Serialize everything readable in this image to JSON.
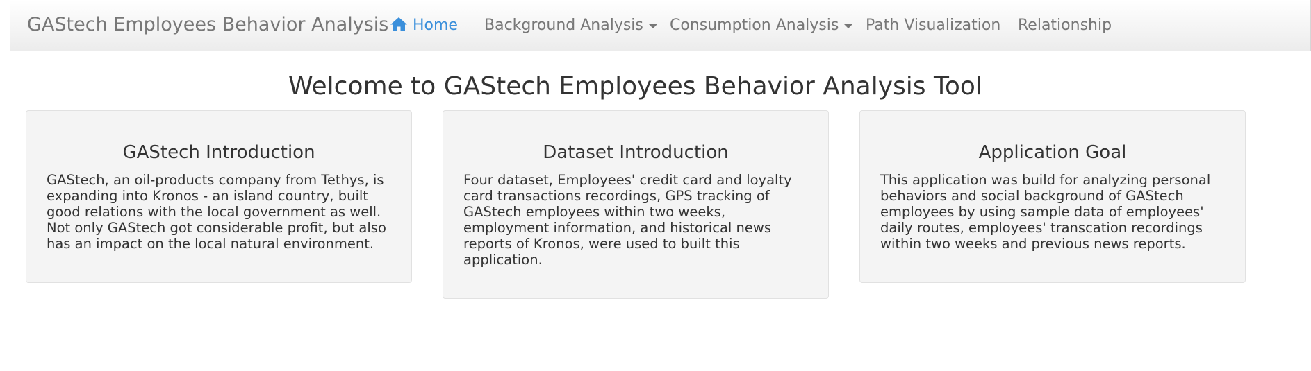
{
  "navbar": {
    "brand": "GAStech Employees Behavior Analysis",
    "items": [
      {
        "label": "Home",
        "active": true,
        "icon": "home-icon"
      },
      {
        "label": "Background Analysis",
        "dropdown": true
      },
      {
        "label": "Consumption Analysis",
        "dropdown": true
      },
      {
        "label": "Path Visualization"
      },
      {
        "label": "Relationship"
      }
    ],
    "active_color": "#3a8fdb"
  },
  "main": {
    "title": "Welcome to GAStech Employees Behavior Analysis Tool",
    "cards": [
      {
        "heading": "GAStech Introduction",
        "body": "GAStech, an oil-products company from Tethys, is expanding into Kronos - an island country, built good relations with the local government as well. Not only GAStech got considerable profit, but also has an impact on the local natural environment."
      },
      {
        "heading": "Dataset Introduction",
        "body": "Four dataset, Employees' credit card and loyalty card transactions recordings, GPS tracking of GAStech employees within two weeks, employment information, and historical news reports of Kronos, were used to built this application."
      },
      {
        "heading": "Application Goal",
        "body": "This application was build for analyzing personal behaviors and social background of GAStech employees by using sample data of employees' daily routes, employees' transcation recordings within two weeks and previous news reports."
      }
    ]
  }
}
